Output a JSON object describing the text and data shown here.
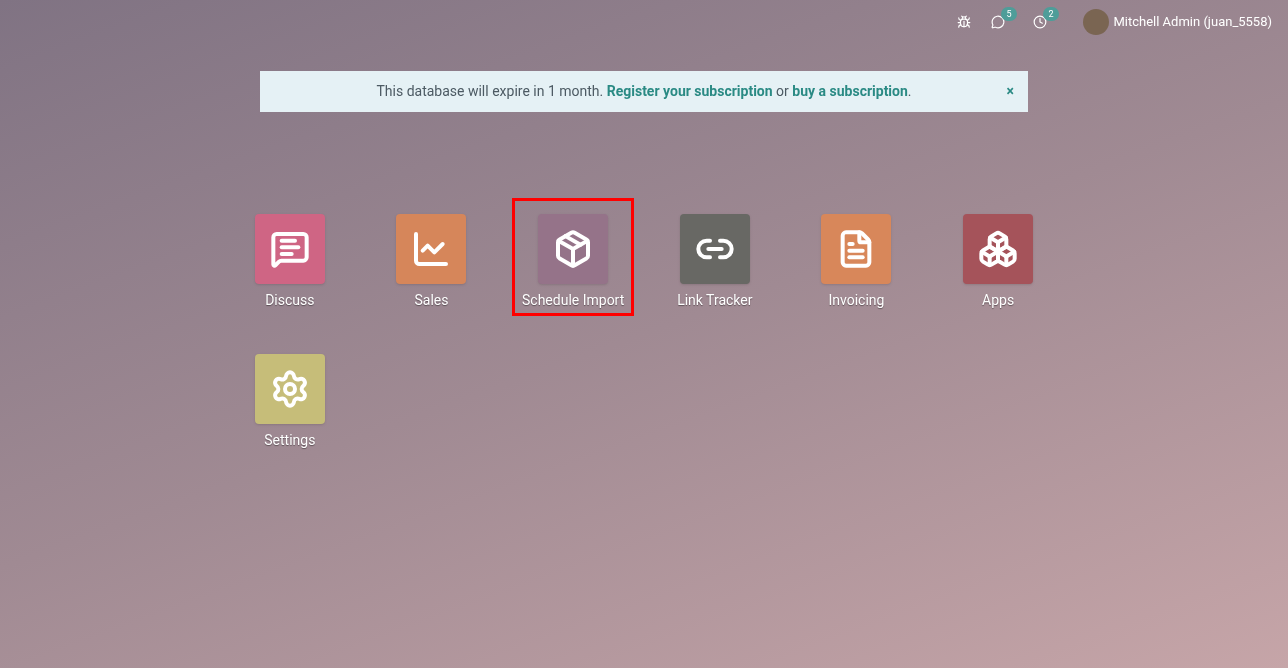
{
  "topbar": {
    "messages_badge": "5",
    "activities_badge": "2",
    "user": "Mitchell Admin (juan_5558)"
  },
  "banner": {
    "parts": [
      {
        "kind": "text",
        "text": "This database will expire in 1 month. "
      },
      {
        "kind": "link",
        "text": "Register your subscription"
      },
      {
        "kind": "text",
        "text": " or "
      },
      {
        "kind": "link",
        "text": "buy a subscription"
      },
      {
        "kind": "text",
        "text": "."
      }
    ],
    "close": "×"
  },
  "apps": [
    {
      "label": "Discuss",
      "kind": "chat",
      "color": "#cf6584",
      "selected": false
    },
    {
      "label": "Sales",
      "kind": "chart",
      "color": "#d6865a",
      "selected": false
    },
    {
      "label": "Schedule Import",
      "kind": "box",
      "color": "#957389",
      "selected": true
    },
    {
      "label": "Link Tracker",
      "kind": "link",
      "color": "#686864",
      "selected": false
    },
    {
      "label": "Invoicing",
      "kind": "invoice",
      "color": "#d8875a",
      "selected": false
    },
    {
      "label": "Apps",
      "kind": "cubes",
      "color": "#a5535a",
      "selected": false
    },
    {
      "label": "Settings",
      "kind": "gear",
      "color": "#c6bd79",
      "selected": false
    }
  ]
}
